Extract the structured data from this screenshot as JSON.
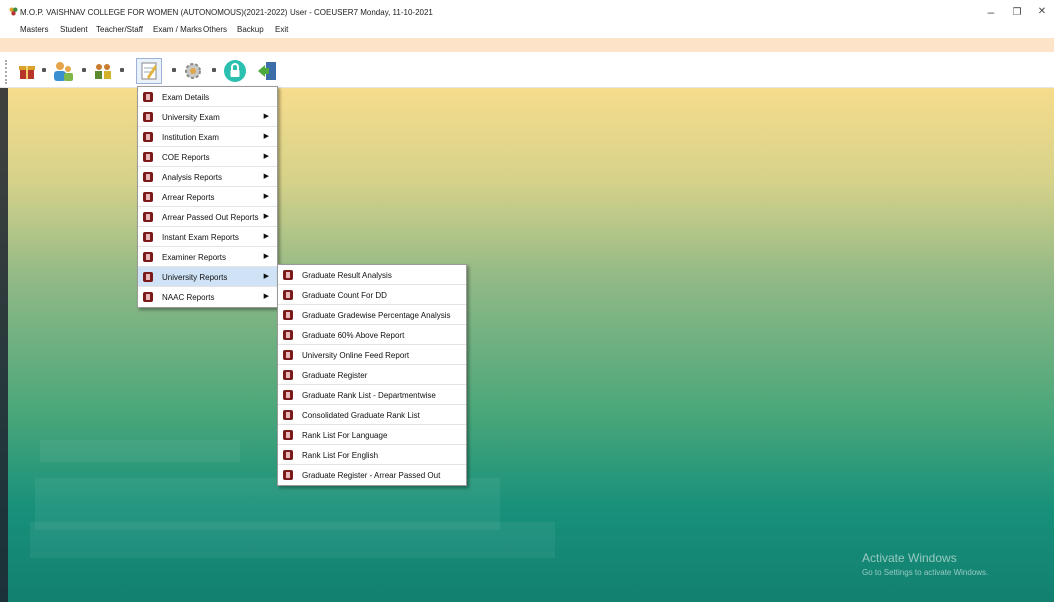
{
  "window": {
    "title": "M.O.P. VAISHNAV COLLEGE FOR WOMEN (AUTONOMOUS)(2021-2022)",
    "user_info": "User - COEUSER7   Monday, 11-10-2021",
    "minimize": "–",
    "restore": "❐",
    "close": "✕"
  },
  "menubar": [
    "Masters",
    "Student",
    "Teacher/Staff",
    "Exam / Marks",
    "Others",
    "Backup",
    "Exit"
  ],
  "toolbar": {
    "icons": [
      "gift-icon",
      "users-icon",
      "people-icon",
      "notepad-icon",
      "settings-icon",
      "lock-icon",
      "exit-door-icon"
    ]
  },
  "exam_menu": {
    "items": [
      {
        "label": "Exam Details",
        "submenu": false
      },
      {
        "label": "University Exam",
        "submenu": true
      },
      {
        "label": "Institution Exam",
        "submenu": true
      },
      {
        "label": "COE Reports",
        "submenu": true
      },
      {
        "label": "Analysis Reports",
        "submenu": true
      },
      {
        "label": "Arrear Reports",
        "submenu": true
      },
      {
        "label": "Arrear Passed Out Reports",
        "submenu": true
      },
      {
        "label": "Instant Exam Reports",
        "submenu": true
      },
      {
        "label": "Examiner Reports",
        "submenu": true
      },
      {
        "label": "University Reports",
        "submenu": true,
        "highlighted": true
      },
      {
        "label": "NAAC Reports",
        "submenu": true
      }
    ]
  },
  "university_reports_menu": {
    "items": [
      "Graduate Result Analysis",
      "Graduate Count For DD",
      "Graduate Gradewise Percentage Analysis",
      "Graduate 60% Above Report",
      "University Online Feed Report",
      "Graduate Register",
      "Graduate Rank List - Departmentwise",
      "Consolidated Graduate Rank List",
      "Rank List For Language",
      "Rank List For English",
      "Graduate Register - Arrear Passed Out"
    ]
  },
  "watermark": {
    "line1": "Activate Windows",
    "line2": "Go to Settings to activate Windows."
  }
}
